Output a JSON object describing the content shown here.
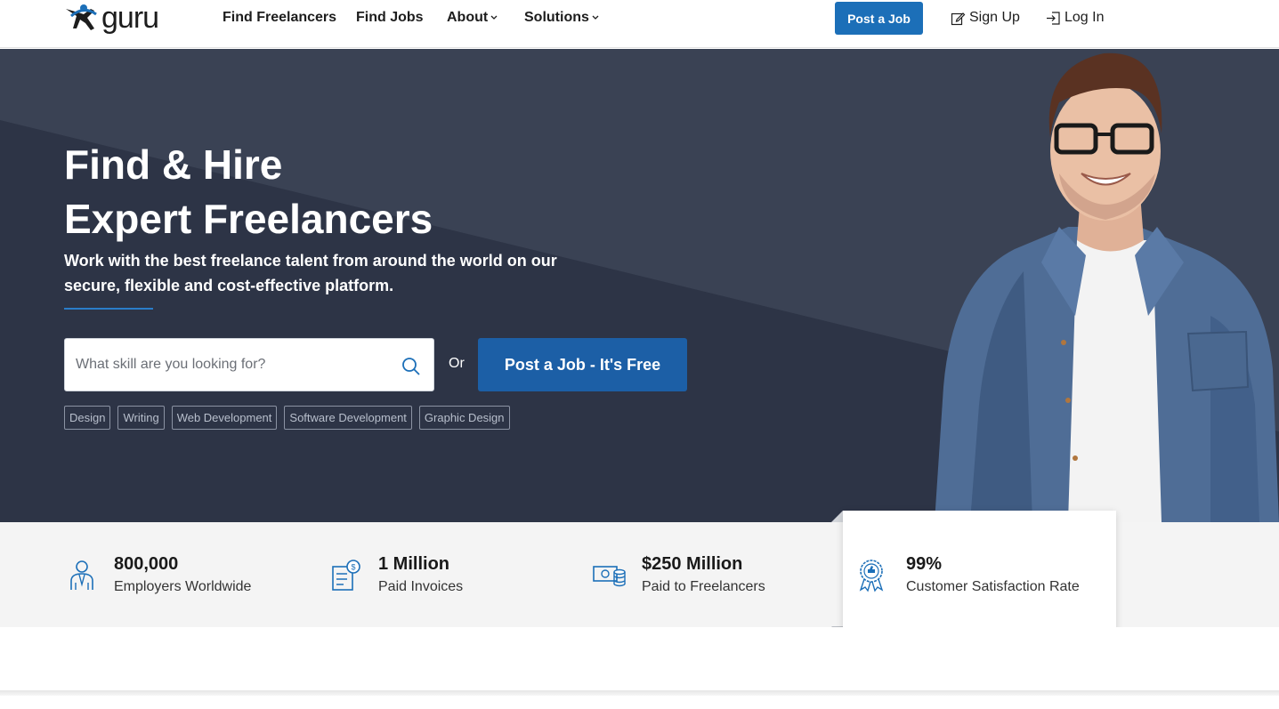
{
  "header": {
    "logo_text": "guru",
    "nav": [
      {
        "label": "Find Freelancers"
      },
      {
        "label": "Find Jobs"
      },
      {
        "label": "About"
      },
      {
        "label": "Solutions"
      }
    ],
    "post_job_label": "Post a Job",
    "sign_up_label": "Sign Up",
    "log_in_label": "Log In"
  },
  "hero": {
    "title_line1": "Find & Hire",
    "title_line2": "Expert Freelancers",
    "subtitle": "Work with the best freelance talent from around the world on our secure, flexible and cost-effective platform.",
    "search_placeholder": "What skill are you looking for?",
    "or_label": "Or",
    "post_job_free_label": "Post a Job - It's Free",
    "tags": [
      "Design",
      "Writing",
      "Web Development",
      "Software Development",
      "Graphic Design"
    ]
  },
  "stats": [
    {
      "icon": "employer-icon",
      "value": "800,000",
      "label": "Employers Worldwide"
    },
    {
      "icon": "invoice-icon",
      "value": "1 Million",
      "label": "Paid Invoices"
    },
    {
      "icon": "money-icon",
      "value": "$250 Million",
      "label": "Paid to Freelancers"
    },
    {
      "icon": "award-badge-icon",
      "value": "99%",
      "label": "Customer Satisfaction Rate"
    }
  ],
  "colors": {
    "brand_blue": "#1c6fb8",
    "hero_bg": "#3a4254",
    "hero_dark": "#2d3446",
    "stats_bg": "#f4f4f4",
    "icon_blue": "#1c6fb8"
  }
}
